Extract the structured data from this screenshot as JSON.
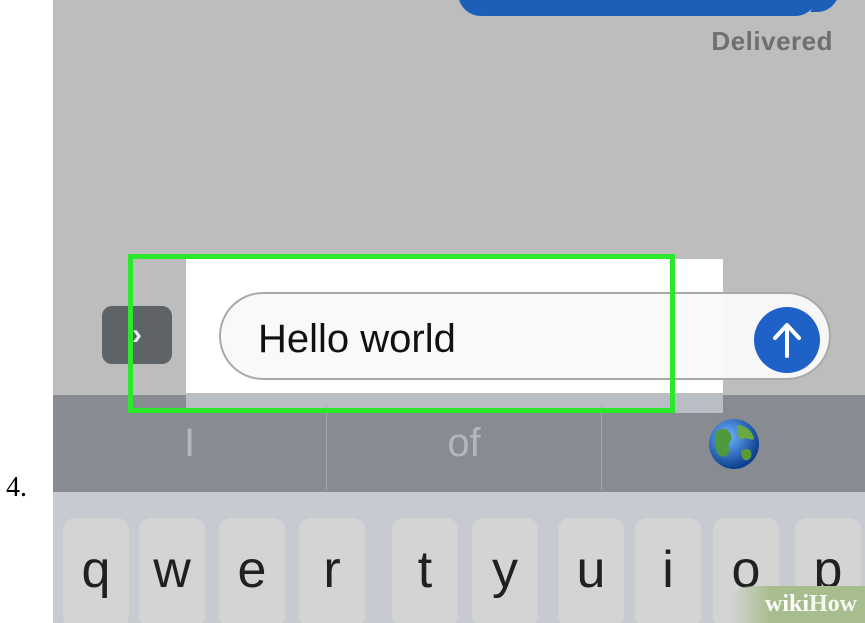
{
  "step": {
    "number": "4."
  },
  "chat": {
    "status": "Delivered"
  },
  "composer": {
    "expand_icon": "chevron-right-icon",
    "message_value": "Hello world",
    "send_icon": "arrow-up-icon"
  },
  "suggestions": {
    "items": [
      "I",
      "of"
    ],
    "emoji": "🌍"
  },
  "keyboard": {
    "row1": [
      "q",
      "w",
      "e",
      "r",
      "t",
      "y",
      "u",
      "i",
      "o",
      "p"
    ]
  },
  "watermark": {
    "part1": "wiki",
    "part2": "How"
  },
  "colors": {
    "highlight": "#2ce82c",
    "send_button": "#1f62c7",
    "bubble": "#1c5fb8"
  }
}
